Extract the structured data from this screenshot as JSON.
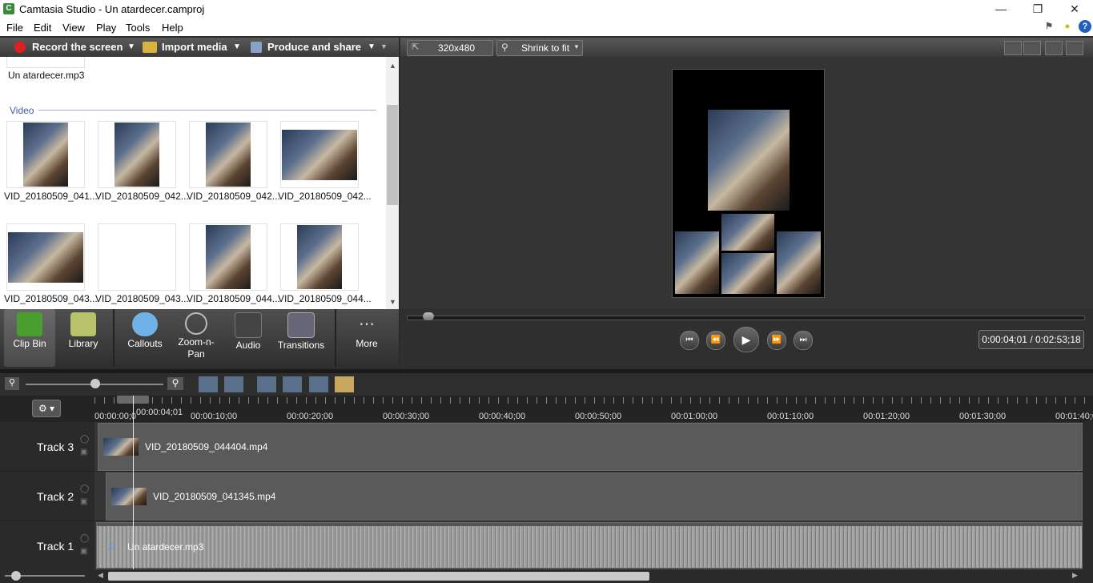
{
  "window": {
    "title": "Camtasia Studio - Un atardecer.camproj",
    "app_icon": "C"
  },
  "menu": [
    "File",
    "Edit",
    "View",
    "Play",
    "Tools",
    "Help"
  ],
  "toolbar": {
    "record": "Record the screen",
    "import": "Import media",
    "produce": "Produce and share"
  },
  "clip_bin": {
    "audio_file": "Un atardecer.mp3",
    "section_video": "Video",
    "items": [
      "VID_20180509_041...",
      "VID_20180509_042...",
      "VID_20180509_042...",
      "VID_20180509_042...",
      "VID_20180509_043...",
      "VID_20180509_043...",
      "VID_20180509_044...",
      "VID_20180509_044..."
    ]
  },
  "tools": {
    "clip_bin": "Clip Bin",
    "library": "Library",
    "callouts": "Callouts",
    "zoom": "Zoom-n-\nPan",
    "audio": "Audio",
    "transitions": "Transitions",
    "more": "More"
  },
  "preview": {
    "dimensions": "320x480",
    "fit": "Shrink to fit",
    "timecode": "0:00:04;01 / 0:02:53;18"
  },
  "timeline": {
    "playhead_time": "00:00:04;01",
    "ticks": [
      "00:00:00;0",
      "00:00:10;00",
      "00:00:20;00",
      "00:00:30;00",
      "00:00:40;00",
      "00:00:50;00",
      "00:01:00;00",
      "00:01:10;00",
      "00:01:20;00",
      "00:01:30;00",
      "00:01:40;0"
    ],
    "tracks": [
      {
        "name": "Track 3",
        "clip": "VID_20180509_044404.mp4"
      },
      {
        "name": "Track 2",
        "clip": "VID_20180509_041345.mp4"
      },
      {
        "name": "Track 1",
        "clip": "Un atardecer.mp3"
      }
    ]
  },
  "colors": {
    "accent_green": "#3a8a3a",
    "record_red": "#e02020",
    "waveform": "#9a9a9a"
  }
}
